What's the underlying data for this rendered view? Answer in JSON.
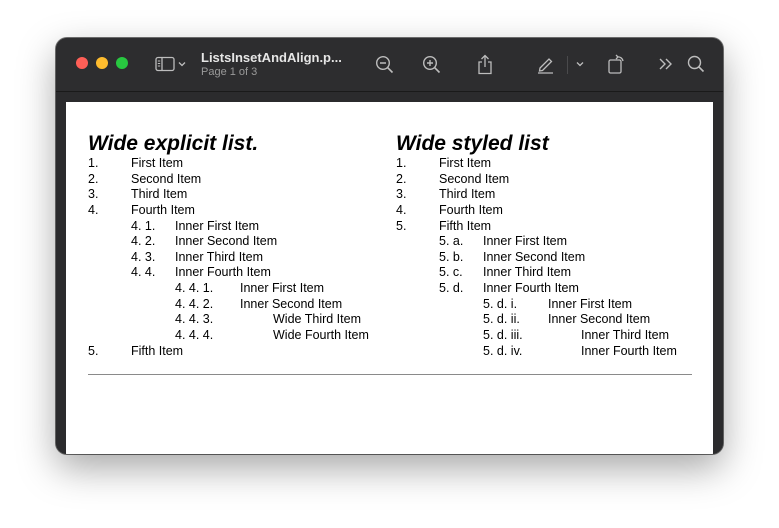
{
  "window": {
    "title": "ListsInsetAndAlign.p...",
    "subtitle": "Page 1 of 3",
    "traffic_colors": {
      "close": "#ff5f57",
      "minimize": "#febc2e",
      "zoom": "#28c840"
    }
  },
  "toolbar": {
    "icons": [
      "sidebar-toggle-icon",
      "chevron-down-icon",
      "zoom-out-icon",
      "zoom-in-icon",
      "share-icon",
      "markup-pen-icon",
      "chevron-down-icon",
      "rotate-icon",
      "more-chevrons-icon",
      "search-icon"
    ]
  },
  "left_list": {
    "title": "Wide explicit list.",
    "items": [
      {
        "marker": "1.",
        "text": "First Item"
      },
      {
        "marker": "2.",
        "text": "Second Item"
      },
      {
        "marker": "3.",
        "text": "Third Item"
      },
      {
        "marker": "4.",
        "text": "Fourth Item"
      },
      {
        "marker": "4. 1.",
        "text": "Inner First Item"
      },
      {
        "marker": "4. 2.",
        "text": "Inner Second Item"
      },
      {
        "marker": "4. 3.",
        "text": "Inner Third Item"
      },
      {
        "marker": "4. 4.",
        "text": "Inner Fourth Item"
      },
      {
        "marker": "4. 4. 1.",
        "text": "Inner First Item"
      },
      {
        "marker": "4. 4. 2.",
        "text": "Inner Second Item"
      },
      {
        "marker": "4. 4. 3.",
        "text": "Wide Third Item"
      },
      {
        "marker": "4. 4. 4.",
        "text": "Wide Fourth Item"
      },
      {
        "marker": "5.",
        "text": "Fifth Item"
      }
    ]
  },
  "right_list": {
    "title": "Wide styled list",
    "items": [
      {
        "marker": "1.",
        "text": "First Item"
      },
      {
        "marker": "2.",
        "text": "Second Item"
      },
      {
        "marker": "3.",
        "text": "Third Item"
      },
      {
        "marker": "4.",
        "text": "Fourth Item"
      },
      {
        "marker": "5.",
        "text": "Fifth Item"
      },
      {
        "marker": "5. a.",
        "text": "Inner First Item"
      },
      {
        "marker": "5. b.",
        "text": "Inner Second Item"
      },
      {
        "marker": "5. c.",
        "text": "Inner Third Item"
      },
      {
        "marker": "5. d.",
        "text": "Inner Fourth Item"
      },
      {
        "marker": "5. d. i.",
        "text": "Inner First Item"
      },
      {
        "marker": "5. d. ii.",
        "text": "Inner Second Item"
      },
      {
        "marker": "5. d. iii.",
        "text": "Inner Third Item"
      },
      {
        "marker": "5. d. iv.",
        "text": "Inner Fourth Item"
      }
    ]
  }
}
